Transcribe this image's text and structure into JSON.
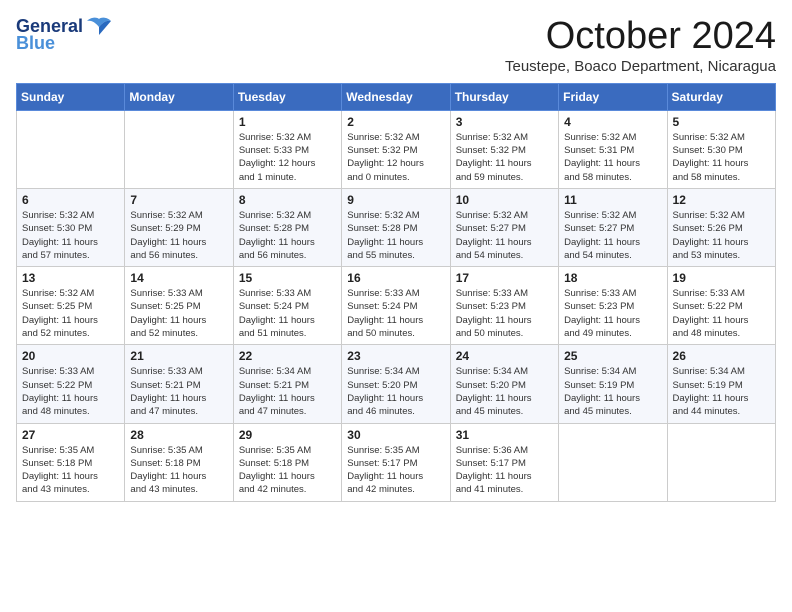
{
  "header": {
    "logo_line1": "General",
    "logo_line2": "Blue",
    "month": "October 2024",
    "location": "Teustepe, Boaco Department, Nicaragua"
  },
  "days_of_week": [
    "Sunday",
    "Monday",
    "Tuesday",
    "Wednesday",
    "Thursday",
    "Friday",
    "Saturday"
  ],
  "weeks": [
    [
      {
        "day": "",
        "info": ""
      },
      {
        "day": "",
        "info": ""
      },
      {
        "day": "1",
        "info": "Sunrise: 5:32 AM\nSunset: 5:33 PM\nDaylight: 12 hours\nand 1 minute."
      },
      {
        "day": "2",
        "info": "Sunrise: 5:32 AM\nSunset: 5:32 PM\nDaylight: 12 hours\nand 0 minutes."
      },
      {
        "day": "3",
        "info": "Sunrise: 5:32 AM\nSunset: 5:32 PM\nDaylight: 11 hours\nand 59 minutes."
      },
      {
        "day": "4",
        "info": "Sunrise: 5:32 AM\nSunset: 5:31 PM\nDaylight: 11 hours\nand 58 minutes."
      },
      {
        "day": "5",
        "info": "Sunrise: 5:32 AM\nSunset: 5:30 PM\nDaylight: 11 hours\nand 58 minutes."
      }
    ],
    [
      {
        "day": "6",
        "info": "Sunrise: 5:32 AM\nSunset: 5:30 PM\nDaylight: 11 hours\nand 57 minutes."
      },
      {
        "day": "7",
        "info": "Sunrise: 5:32 AM\nSunset: 5:29 PM\nDaylight: 11 hours\nand 56 minutes."
      },
      {
        "day": "8",
        "info": "Sunrise: 5:32 AM\nSunset: 5:28 PM\nDaylight: 11 hours\nand 56 minutes."
      },
      {
        "day": "9",
        "info": "Sunrise: 5:32 AM\nSunset: 5:28 PM\nDaylight: 11 hours\nand 55 minutes."
      },
      {
        "day": "10",
        "info": "Sunrise: 5:32 AM\nSunset: 5:27 PM\nDaylight: 11 hours\nand 54 minutes."
      },
      {
        "day": "11",
        "info": "Sunrise: 5:32 AM\nSunset: 5:27 PM\nDaylight: 11 hours\nand 54 minutes."
      },
      {
        "day": "12",
        "info": "Sunrise: 5:32 AM\nSunset: 5:26 PM\nDaylight: 11 hours\nand 53 minutes."
      }
    ],
    [
      {
        "day": "13",
        "info": "Sunrise: 5:32 AM\nSunset: 5:25 PM\nDaylight: 11 hours\nand 52 minutes."
      },
      {
        "day": "14",
        "info": "Sunrise: 5:33 AM\nSunset: 5:25 PM\nDaylight: 11 hours\nand 52 minutes."
      },
      {
        "day": "15",
        "info": "Sunrise: 5:33 AM\nSunset: 5:24 PM\nDaylight: 11 hours\nand 51 minutes."
      },
      {
        "day": "16",
        "info": "Sunrise: 5:33 AM\nSunset: 5:24 PM\nDaylight: 11 hours\nand 50 minutes."
      },
      {
        "day": "17",
        "info": "Sunrise: 5:33 AM\nSunset: 5:23 PM\nDaylight: 11 hours\nand 50 minutes."
      },
      {
        "day": "18",
        "info": "Sunrise: 5:33 AM\nSunset: 5:23 PM\nDaylight: 11 hours\nand 49 minutes."
      },
      {
        "day": "19",
        "info": "Sunrise: 5:33 AM\nSunset: 5:22 PM\nDaylight: 11 hours\nand 48 minutes."
      }
    ],
    [
      {
        "day": "20",
        "info": "Sunrise: 5:33 AM\nSunset: 5:22 PM\nDaylight: 11 hours\nand 48 minutes."
      },
      {
        "day": "21",
        "info": "Sunrise: 5:33 AM\nSunset: 5:21 PM\nDaylight: 11 hours\nand 47 minutes."
      },
      {
        "day": "22",
        "info": "Sunrise: 5:34 AM\nSunset: 5:21 PM\nDaylight: 11 hours\nand 47 minutes."
      },
      {
        "day": "23",
        "info": "Sunrise: 5:34 AM\nSunset: 5:20 PM\nDaylight: 11 hours\nand 46 minutes."
      },
      {
        "day": "24",
        "info": "Sunrise: 5:34 AM\nSunset: 5:20 PM\nDaylight: 11 hours\nand 45 minutes."
      },
      {
        "day": "25",
        "info": "Sunrise: 5:34 AM\nSunset: 5:19 PM\nDaylight: 11 hours\nand 45 minutes."
      },
      {
        "day": "26",
        "info": "Sunrise: 5:34 AM\nSunset: 5:19 PM\nDaylight: 11 hours\nand 44 minutes."
      }
    ],
    [
      {
        "day": "27",
        "info": "Sunrise: 5:35 AM\nSunset: 5:18 PM\nDaylight: 11 hours\nand 43 minutes."
      },
      {
        "day": "28",
        "info": "Sunrise: 5:35 AM\nSunset: 5:18 PM\nDaylight: 11 hours\nand 43 minutes."
      },
      {
        "day": "29",
        "info": "Sunrise: 5:35 AM\nSunset: 5:18 PM\nDaylight: 11 hours\nand 42 minutes."
      },
      {
        "day": "30",
        "info": "Sunrise: 5:35 AM\nSunset: 5:17 PM\nDaylight: 11 hours\nand 42 minutes."
      },
      {
        "day": "31",
        "info": "Sunrise: 5:36 AM\nSunset: 5:17 PM\nDaylight: 11 hours\nand 41 minutes."
      },
      {
        "day": "",
        "info": ""
      },
      {
        "day": "",
        "info": ""
      }
    ]
  ]
}
